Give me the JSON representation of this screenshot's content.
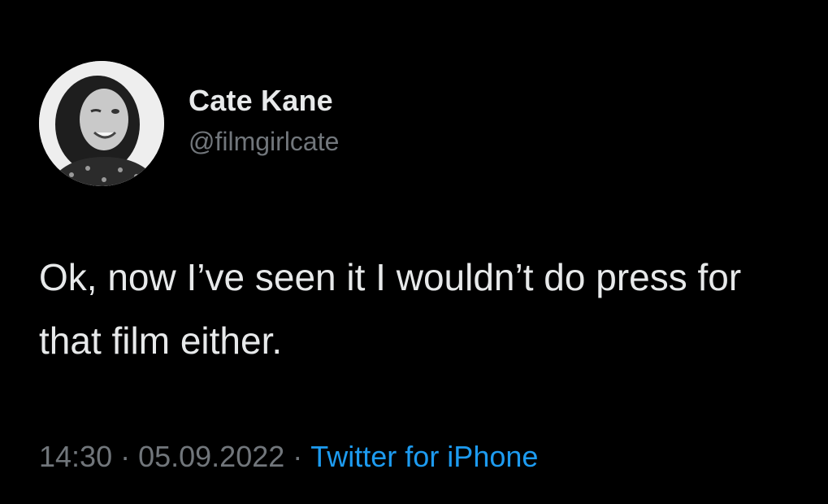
{
  "author": {
    "display_name": "Cate Kane",
    "handle": "@filmgirlcate",
    "avatar_icon": "avatar-photo"
  },
  "tweet": {
    "text": "Ok, now I’ve seen it I wouldn’t do press for that film either."
  },
  "meta": {
    "time": "14:30",
    "separator": "·",
    "date": "05.09.2022",
    "source": "Twitter for iPhone"
  },
  "colors": {
    "background": "#000000",
    "primary_text": "#e7e9ea",
    "secondary_text": "#71767b",
    "link": "#1d9bf0"
  }
}
